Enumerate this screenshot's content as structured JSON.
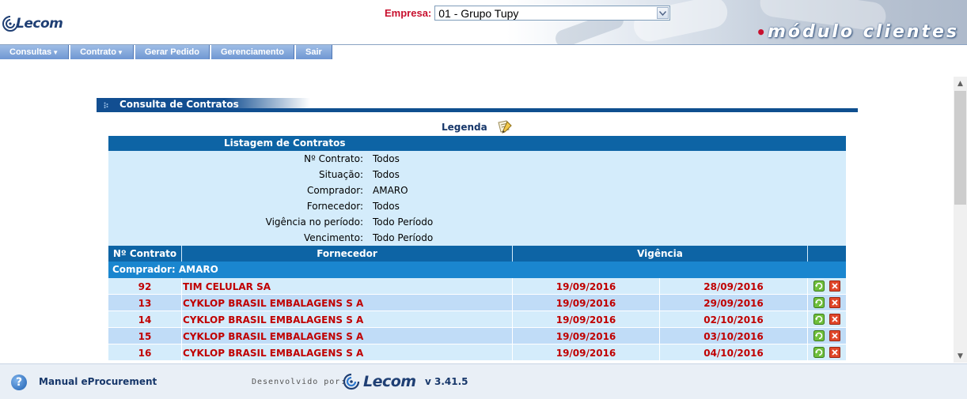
{
  "header": {
    "logo_text": "Lecom",
    "empresa_label": "Empresa:",
    "empresa_value": "01 - Grupo Tupy",
    "module_title": "módulo clientes"
  },
  "menu": [
    {
      "label": "Consultas",
      "dropdown": true
    },
    {
      "label": "Contrato",
      "dropdown": true
    },
    {
      "label": "Gerar Pedido",
      "dropdown": false
    },
    {
      "label": "Gerenciamento",
      "dropdown": false
    },
    {
      "label": "Sair",
      "dropdown": false
    }
  ],
  "panel": {
    "title": "Consulta de Contratos",
    "legenda": "Legenda"
  },
  "listing": {
    "title": "Listagem de Contratos",
    "filters": [
      {
        "label": "Nº Contrato:",
        "value": "Todos"
      },
      {
        "label": "Situação:",
        "value": "Todos"
      },
      {
        "label": "Comprador:",
        "value": "AMARO"
      },
      {
        "label": "Fornecedor:",
        "value": "Todos"
      },
      {
        "label": "Vigência no período:",
        "value": "Todo Período"
      },
      {
        "label": "Vencimento:",
        "value": "Todo Período"
      }
    ],
    "columns": {
      "numero": "Nº Contrato",
      "fornecedor": "Fornecedor",
      "vigencia": "Vigência"
    },
    "group_label": "Comprador: AMARO",
    "rows": [
      {
        "numero": "92",
        "fornecedor": "TIM CELULAR SA",
        "inicio": "19/09/2016",
        "fim": "28/09/2016"
      },
      {
        "numero": "13",
        "fornecedor": "CYKLOP BRASIL EMBALAGENS S A",
        "inicio": "19/09/2016",
        "fim": "29/09/2016"
      },
      {
        "numero": "14",
        "fornecedor": "CYKLOP BRASIL EMBALAGENS S A",
        "inicio": "19/09/2016",
        "fim": "02/10/2016"
      },
      {
        "numero": "15",
        "fornecedor": "CYKLOP BRASIL EMBALAGENS S A",
        "inicio": "19/09/2016",
        "fim": "03/10/2016"
      },
      {
        "numero": "16",
        "fornecedor": "CYKLOP BRASIL EMBALAGENS S A",
        "inicio": "19/09/2016",
        "fim": "04/10/2016"
      }
    ]
  },
  "footer": {
    "manual": "Manual eProcurement",
    "desenvolvido": "Desenvolvido por:",
    "logo_text": "Lecom",
    "version": "v 3.41.5"
  },
  "colors": {
    "primary_blue": "#0d64a5",
    "group_blue": "#1a86cf",
    "row_light": "#d4ecfb",
    "row_alt": "#c0dcf7",
    "contract_red": "#c00000",
    "label_red": "#c8102e"
  },
  "icons": {
    "renew": "renew-contract-icon",
    "delete": "delete-contract-icon",
    "help": "help-icon",
    "legenda": "legend-icon"
  }
}
